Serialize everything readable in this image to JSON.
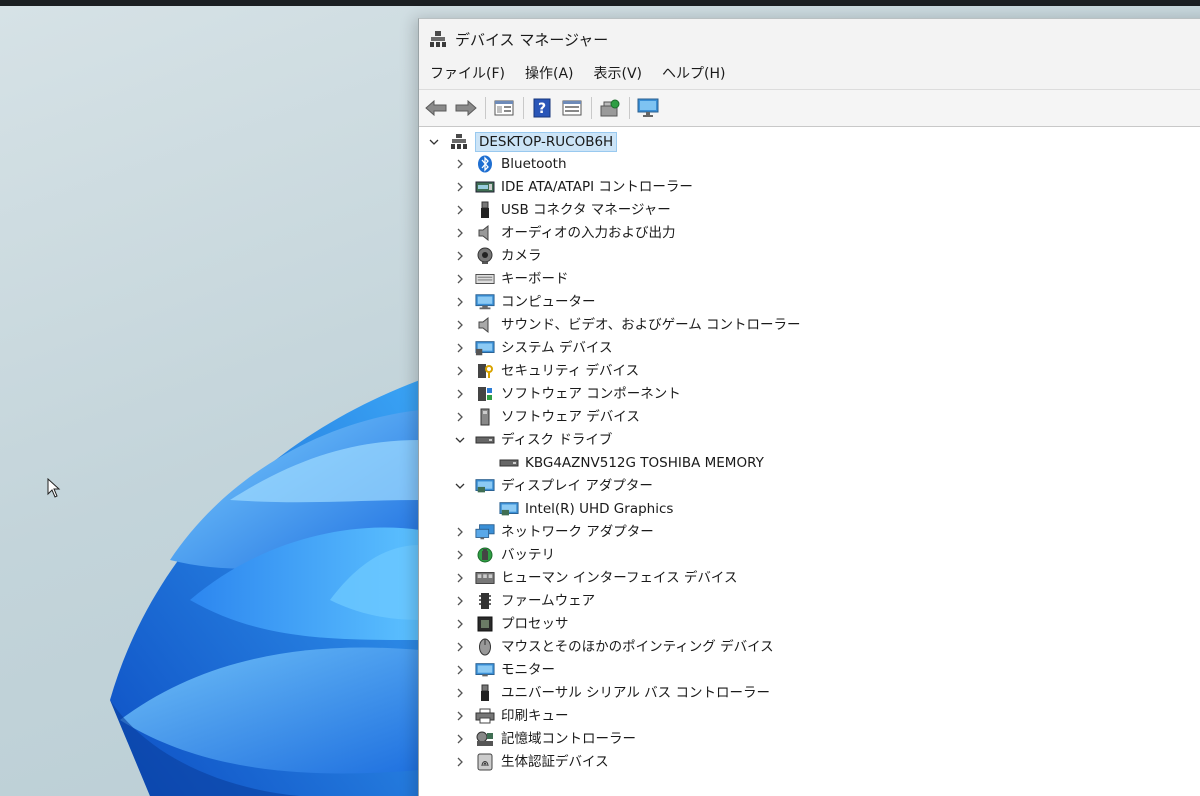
{
  "window": {
    "title": "デバイス マネージャー"
  },
  "menu": {
    "items": [
      "ファイル(F)",
      "操作(A)",
      "表示(V)",
      "ヘルプ(H)"
    ]
  },
  "toolbar": {
    "buttons": [
      "back-icon",
      "forward-icon",
      "properties-icon",
      "help-icon",
      "view-icon",
      "scan-hardware-icon",
      "monitor-icon"
    ]
  },
  "tree": {
    "root": "DESKTOP-RUCOB6H",
    "categories": [
      {
        "label": "Bluetooth",
        "icon": "bluetooth-icon"
      },
      {
        "label": "IDE ATA/ATAPI コントローラー",
        "icon": "ide-controller-icon"
      },
      {
        "label": "USB コネクタ マネージャー",
        "icon": "usb-connector-icon"
      },
      {
        "label": "オーディオの入力および出力",
        "icon": "speaker-icon"
      },
      {
        "label": "カメラ",
        "icon": "camera-icon"
      },
      {
        "label": "キーボード",
        "icon": "keyboard-icon"
      },
      {
        "label": "コンピューター",
        "icon": "computer-icon"
      },
      {
        "label": "サウンド、ビデオ、およびゲーム コントローラー",
        "icon": "sound-icon"
      },
      {
        "label": "システム デバイス",
        "icon": "system-device-icon"
      },
      {
        "label": "セキュリティ デバイス",
        "icon": "security-device-icon"
      },
      {
        "label": "ソフトウェア コンポーネント",
        "icon": "software-component-icon"
      },
      {
        "label": "ソフトウェア デバイス",
        "icon": "software-device-icon"
      },
      {
        "label": "ディスク ドライブ",
        "icon": "disk-drive-icon",
        "expanded": true,
        "children": [
          {
            "label": "KBG4AZNV512G TOSHIBA MEMORY",
            "icon": "disk-drive-icon"
          }
        ]
      },
      {
        "label": "ディスプレイ アダプター",
        "icon": "display-adapter-icon",
        "expanded": true,
        "children": [
          {
            "label": "Intel(R) UHD Graphics",
            "icon": "display-adapter-icon"
          }
        ]
      },
      {
        "label": "ネットワーク アダプター",
        "icon": "network-adapter-icon"
      },
      {
        "label": "バッテリ",
        "icon": "battery-icon"
      },
      {
        "label": "ヒューマン インターフェイス デバイス",
        "icon": "hid-icon"
      },
      {
        "label": "ファームウェア",
        "icon": "firmware-icon"
      },
      {
        "label": "プロセッサ",
        "icon": "processor-icon"
      },
      {
        "label": "マウスとそのほかのポインティング デバイス",
        "icon": "mouse-icon"
      },
      {
        "label": "モニター",
        "icon": "monitor-icon"
      },
      {
        "label": "ユニバーサル シリアル バス コントローラー",
        "icon": "usb-controller-icon"
      },
      {
        "label": "印刷キュー",
        "icon": "printer-icon"
      },
      {
        "label": "記憶域コントローラー",
        "icon": "storage-controller-icon"
      },
      {
        "label": "生体認証デバイス",
        "icon": "biometric-icon"
      }
    ]
  }
}
